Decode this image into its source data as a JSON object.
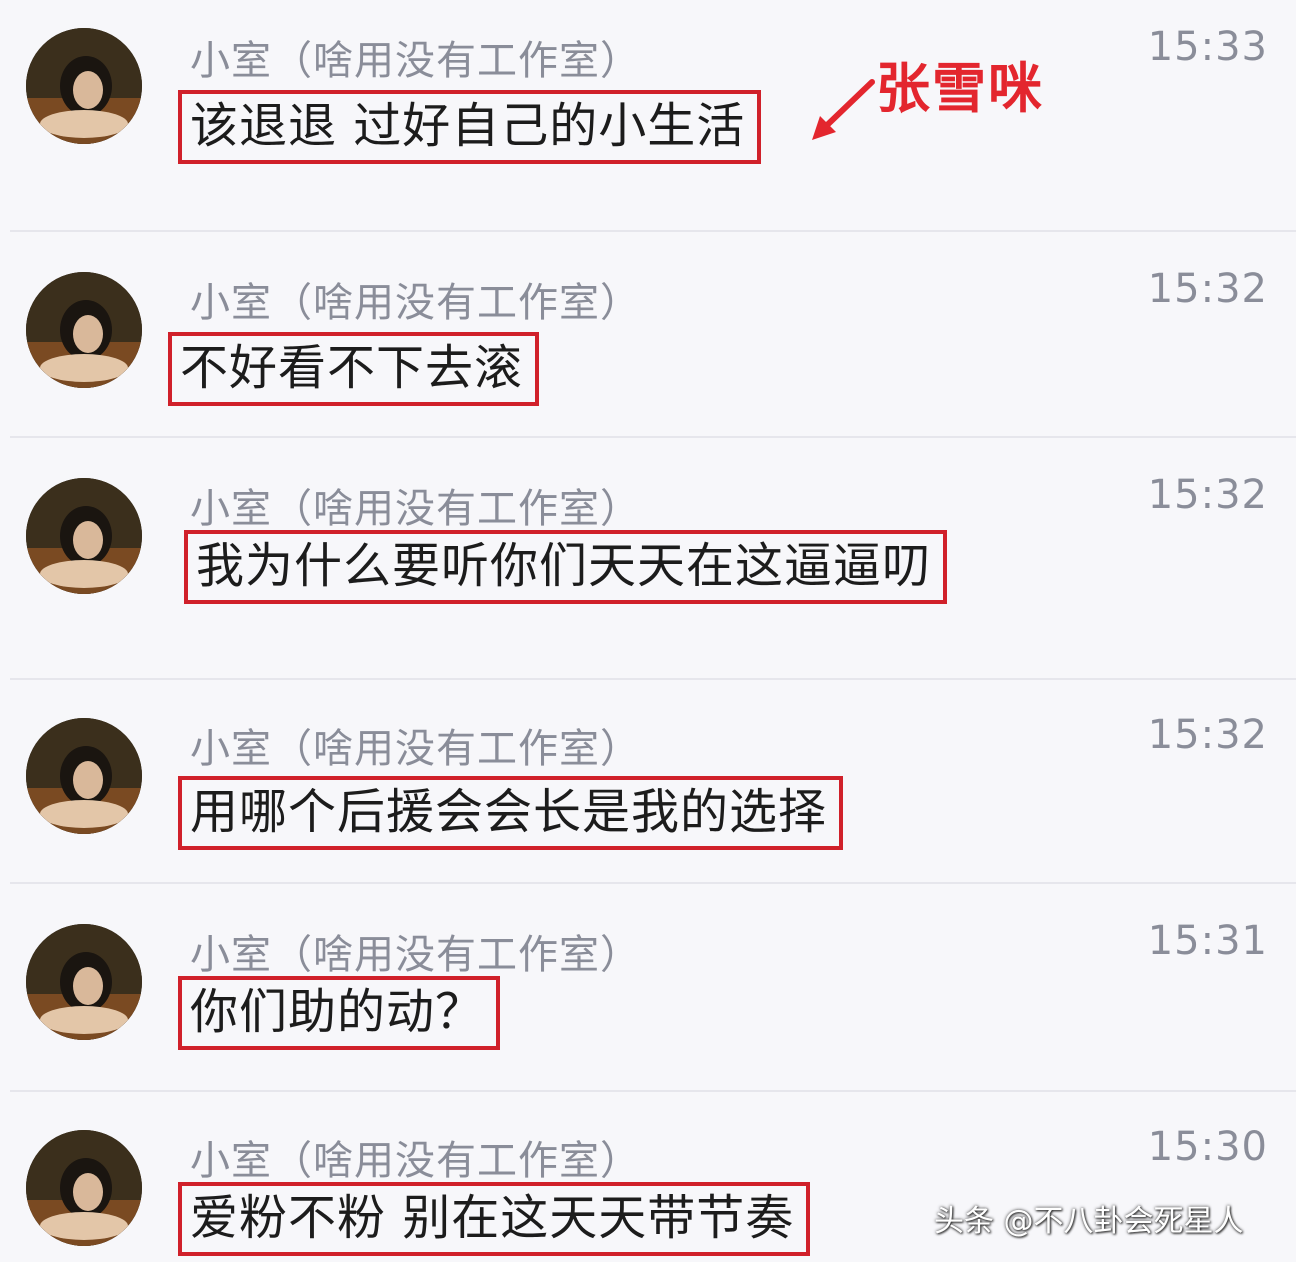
{
  "annotation": {
    "label": "张雪咪"
  },
  "watermark": {
    "text": "头条 @不八卦会死星人"
  },
  "messages": [
    {
      "sender": "小室（啥用没有工作室）",
      "time": "15:33",
      "text": "该退退 过好自己的小生活"
    },
    {
      "sender": "小室（啥用没有工作室）",
      "time": "15:32",
      "text": "不好看不下去滚"
    },
    {
      "sender": "小室（啥用没有工作室）",
      "time": "15:32",
      "text": "我为什么要听你们天天在这逼逼叨"
    },
    {
      "sender": "小室（啥用没有工作室）",
      "time": "15:32",
      "text": "用哪个后援会会长是我的选择"
    },
    {
      "sender": "小室（啥用没有工作室）",
      "time": "15:31",
      "text": "你们助的动？"
    },
    {
      "sender": "小室（啥用没有工作室）",
      "time": "15:30",
      "text": "爱粉不粉 别在这天天带节奏"
    }
  ],
  "colors": {
    "highlight_box": "#d0202a",
    "annotation_red": "#e3262e",
    "meta_gray": "#8a8d99"
  },
  "icons": {
    "avatar": "avatar-photo",
    "annotation_arrow": "red-arrow-icon"
  }
}
